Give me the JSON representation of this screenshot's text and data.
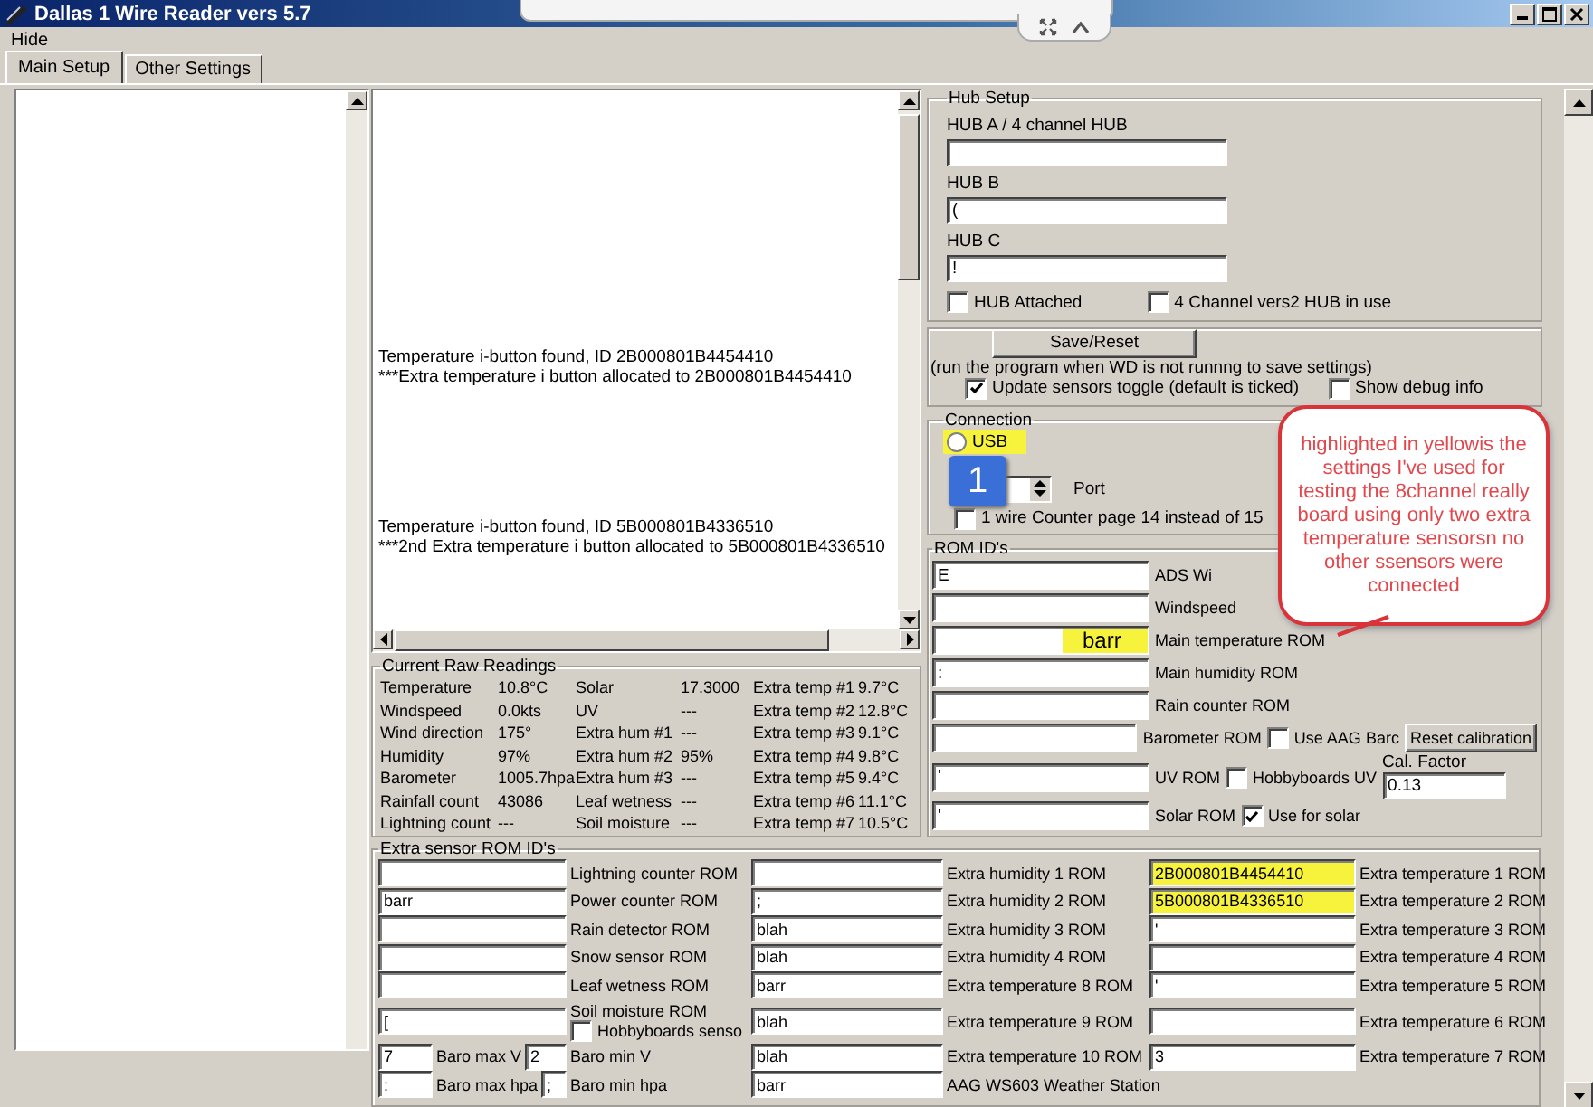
{
  "window": {
    "title": "Dallas 1 Wire Reader vers 5.7"
  },
  "menu": [
    "Hide"
  ],
  "tabs": [
    {
      "label": "Main Setup",
      "selected": true
    },
    {
      "label": "Other Settings",
      "selected": false
    }
  ],
  "log": {
    "entries": [
      {
        "lines": [
          "Temperature i-button found, ID 2B000801B4454410",
          "***Extra temperature i button allocated to 2B000801B4454410"
        ]
      },
      {
        "lines": [
          "Temperature i-button found, ID 5B000801B4336510",
          "***2nd Extra temperature i button allocated to 5B000801B4336510"
        ]
      }
    ]
  },
  "readings": {
    "title": "Current Raw Readings",
    "rows": [
      [
        {
          "label": "Temperature",
          "value": "10.8°C"
        },
        {
          "label": "Solar",
          "value": "17.3000"
        },
        {
          "label": "Extra temp #1",
          "value": "9.7°C"
        }
      ],
      [
        {
          "label": "Windspeed",
          "value": "0.0kts"
        },
        {
          "label": "UV",
          "value": "---"
        },
        {
          "label": "Extra temp #2",
          "value": "12.8°C"
        }
      ],
      [
        {
          "label": "Wind direction",
          "value": "175°"
        },
        {
          "label": "Extra hum #1",
          "value": "---"
        },
        {
          "label": "Extra temp #3",
          "value": "9.1°C"
        }
      ],
      [
        {
          "label": "Humidity",
          "value": "97%"
        },
        {
          "label": "Extra hum #2",
          "value": "95%"
        },
        {
          "label": "Extra temp #4",
          "value": "9.8°C"
        }
      ],
      [
        {
          "label": "Barometer",
          "value": "1005.7hpa"
        },
        {
          "label": "Extra hum #3",
          "value": "---"
        },
        {
          "label": "Extra temp #5",
          "value": "9.4°C"
        }
      ],
      [
        {
          "label": "Rainfall count",
          "value": "43086"
        },
        {
          "label": "Leaf wetness",
          "value": "---"
        },
        {
          "label": "Extra temp #6",
          "value": "11.1°C"
        }
      ],
      [
        {
          "label": "Lightning count",
          "value": "---"
        },
        {
          "label": "Soil moisture",
          "value": "---"
        },
        {
          "label": "Extra temp #7",
          "value": "10.5°C"
        }
      ]
    ]
  },
  "hub_setup": {
    "title": "Hub Setup",
    "fields": [
      {
        "label": "HUB A / 4 channel HUB"
      },
      {
        "label": "HUB B",
        "value": "("
      },
      {
        "label": "HUB C",
        "value": "!"
      }
    ],
    "checkboxes": [
      {
        "label": "HUB Attached",
        "checked": false
      },
      {
        "label": "4 Channel vers2 HUB in use",
        "checked": false
      }
    ]
  },
  "save": {
    "button": "Save/Reset",
    "note": "(run the program when WD is not runnng to save settings)",
    "checkboxes": [
      {
        "label": "Update sensors toggle (default is ticked)",
        "checked": true
      },
      {
        "label": "Show debug info",
        "checked": false
      }
    ]
  },
  "connection": {
    "title": "Connection",
    "options": [
      {
        "label": "USB",
        "selected": false,
        "highlighted": true
      }
    ],
    "port_label": "Port",
    "counter": {
      "label": "1 wire Counter page 14 instead of 15",
      "checked": false
    }
  },
  "rom_ids": {
    "title": "ROM ID's",
    "rows": [
      {
        "field": {
          "value": "E",
          "highlighted": false
        },
        "label": "ADS Wi"
      },
      {
        "field": {
          "highlighted": false
        },
        "label": "Windspeed"
      },
      {
        "field": {
          "value": "barr",
          "highlighted": true
        },
        "label": "Main temperature ROM"
      },
      {
        "field": {
          "value": ":",
          "highlighted": false
        },
        "label": "Main humidity ROM"
      },
      {
        "field": {
          "highlighted": false
        },
        "label": "Rain counter ROM"
      },
      {
        "field": {
          "highlighted": false
        },
        "label": "Barometer ROM",
        "checkbox": {
          "label": "Use AAG Barc",
          "checked": false
        },
        "button": "Reset calibration"
      },
      {
        "field": {
          "value": "'",
          "highlighted": false
        },
        "label": "UV ROM",
        "checkbox": {
          "label": "Hobbyboards UV",
          "checked": false
        },
        "cal_factor": {
          "label": "Cal. Factor",
          "value": "0.13"
        }
      },
      {
        "field": {
          "value": "'",
          "highlighted": false
        },
        "label": "Solar ROM",
        "checkbox": {
          "label": "Use for solar",
          "checked": true
        }
      }
    ]
  },
  "extra_sensors": {
    "title": "Extra sensor ROM ID's",
    "rows": [
      {
        "a": {
          "highlighted": false
        },
        "b": "Lightning counter ROM",
        "c": {
          "highlighted": false
        },
        "d": "Extra humidity 1 ROM",
        "e": {
          "value": "2B000801B4454410",
          "highlighted": true
        },
        "f": "Extra temperature 1 ROM"
      },
      {
        "a": {
          "value": "barr",
          "highlighted": false
        },
        "b": "Power counter ROM",
        "c": {
          "value": ";",
          "highlighted": false
        },
        "d": "Extra humidity 2 ROM",
        "e": {
          "value": "5B000801B4336510",
          "highlighted": true
        },
        "f": "Extra temperature 2 ROM"
      },
      {
        "a": {
          "highlighted": false
        },
        "b": "Rain detector ROM",
        "c": {
          "value": "blah",
          "highlighted": false
        },
        "d": "Extra humidity 3 ROM",
        "e": {
          "value": "'",
          "highlighted": false
        },
        "f": "Extra temperature 3 ROM"
      },
      {
        "a": {
          "highlighted": false
        },
        "b": "Snow sensor ROM",
        "c": {
          "value": "blah",
          "highlighted": false
        },
        "d": "Extra humidity 4 ROM",
        "e": {
          "highlighted": false
        },
        "f": "Extra temperature 4 ROM"
      },
      {
        "a": {
          "highlighted": false
        },
        "b": "Leaf wetness  ROM",
        "c": {
          "value": "barr",
          "highlighted": false
        },
        "d": "Extra temperature 8 ROM",
        "e": {
          "value": "'",
          "highlighted": false
        },
        "f": "Extra temperature 5 ROM"
      },
      {
        "a": {
          "value": "[",
          "highlighted": false
        },
        "b": "Soil moisture  ROM",
        "checkbox": {
          "label": "Hobbyboards senso",
          "checked": false
        },
        "c": {
          "value": "blah",
          "highlighted": false
        },
        "d": "Extra temperature 9 ROM",
        "e": {
          "highlighted": false
        },
        "f": "Extra temperature 6 ROM"
      },
      {
        "a": {
          "value": "7",
          "highlighted": false
        },
        "a_label": "Baro max V",
        "a2": {
          "value": "2",
          "highlighted": false
        },
        "b": "Baro min V",
        "c": {
          "value": "blah",
          "highlighted": false
        },
        "d": "Extra temperature 10 ROM",
        "e": {
          "value": "3",
          "highlighted": false
        },
        "f": "Extra temperature 7 ROM"
      },
      {
        "a": {
          "value": ":",
          "highlighted": false
        },
        "a_label": "Baro max hpa",
        "a2": {
          "value": ";",
          "highlighted": false
        },
        "b": "Baro min hpa",
        "c": {
          "value": "barr",
          "highlighted": false
        },
        "d": "AAG WS603 Weather Station"
      }
    ]
  },
  "annotations": {
    "callout": "highlighted in yellowis the settings I've used for testing the  8channel really board using only two extra temperature sensorsn no other ssensors were connected",
    "badge": "1"
  }
}
